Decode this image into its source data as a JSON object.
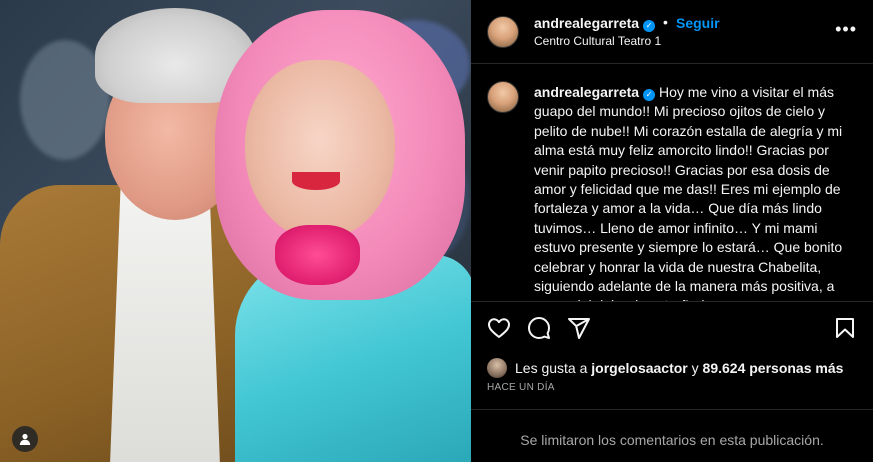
{
  "post": {
    "username": "andrealegarreta",
    "verified_icon": "✓",
    "separator": "•",
    "follow_label": "Seguir",
    "location": "Centro Cultural Teatro 1",
    "more_icon": "more-options-icon",
    "caption": "Hoy me vino a visitar el más guapo del mundo!! Mi precioso ojitos de cielo y pelito de nube!! Mi corazón estalla de alegría y mi alma está muy feliz amorcito lindo!! Gracias por venir papito precioso!! Gracias por esa dosis de amor y felicidad que me das!! Eres mi ejemplo de fortaleza y amor a la vida… Que día más lindo tuvimos… Lleno de amor infinito… Y mi mami estuvo presente y siempre lo estará… Que bonito celebrar y honrar la vida de nuestra Chabelita, siguiendo adelante de la manera más positiva, a pesar del dolor de extrañarla",
    "likes": {
      "prefix": "Les gusta a ",
      "user": "jorgelosaactor",
      "middle": " y ",
      "count": "89.624 personas más"
    },
    "timestamp": "HACE UN DÍA",
    "comments_disabled": "Se limitaron los comentarios en esta publicación."
  },
  "icons": {
    "like": "heart-icon",
    "comment": "comment-icon",
    "share": "share-icon",
    "save": "bookmark-icon",
    "tag": "user-tag-icon"
  },
  "colors": {
    "background": "#000000",
    "text": "#f5f5f5",
    "secondary": "#a8a8a8",
    "accent": "#0095f6",
    "divider": "#262626"
  }
}
